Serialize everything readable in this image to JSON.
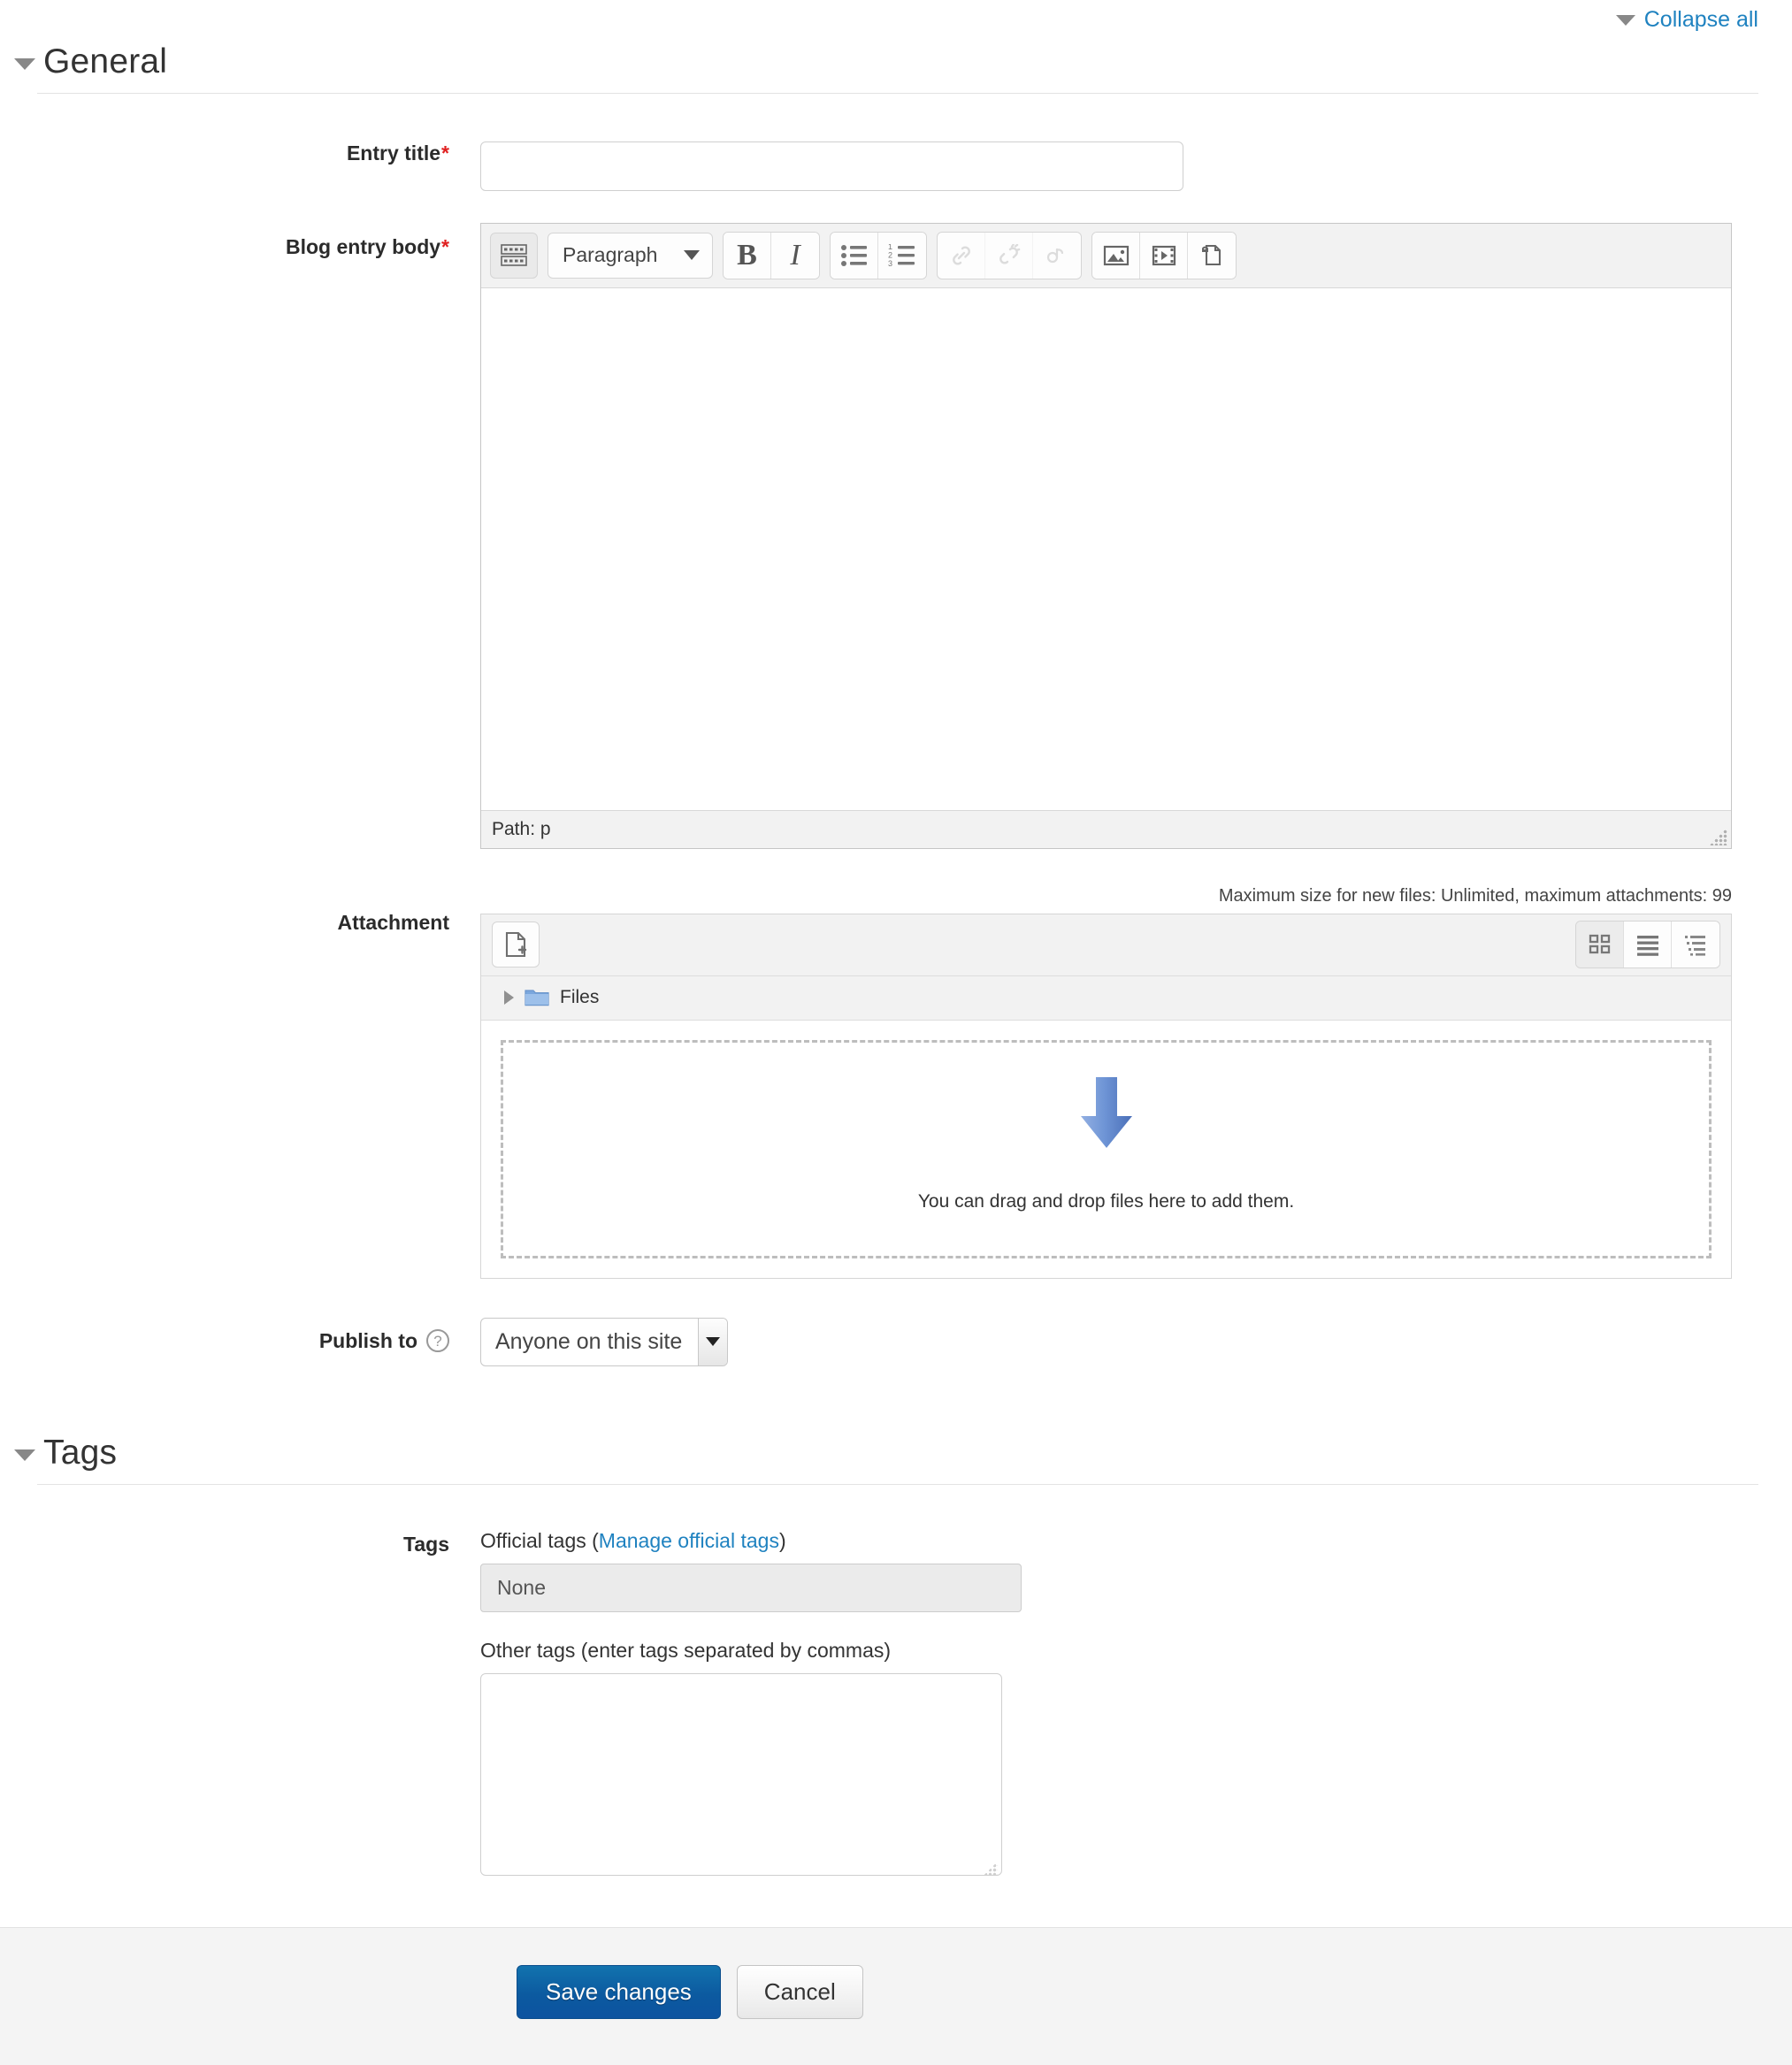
{
  "header": {
    "collapse_all": "Collapse all"
  },
  "sections": {
    "general": {
      "title": "General"
    },
    "tags": {
      "title": "Tags"
    }
  },
  "form": {
    "entry_title": {
      "label": "Entry title",
      "required_mark": "*",
      "value": "",
      "placeholder": ""
    },
    "blog_entry_body": {
      "label": "Blog entry body",
      "required_mark": "*",
      "value": "",
      "path_label": "Path: p",
      "toolbar": {
        "expand_label": "",
        "format_select": "Paragraph",
        "bold_label": "B",
        "italic_label": "I",
        "icons": [
          "expand-toolbar-icon",
          "bold-icon",
          "italic-icon",
          "bulleted-list-icon",
          "numbered-list-icon",
          "link-icon",
          "unlink-icon",
          "auto-link-icon",
          "image-icon",
          "media-icon",
          "manage-files-icon"
        ]
      }
    },
    "attachment": {
      "label": "Attachment",
      "max_size_text": "Maximum size for new files: Unlimited, maximum attachments: 99",
      "add_file_label": "",
      "breadcrumb_root": "Files",
      "dropzone_text": "You can drag and drop files here to add them.",
      "view_modes": [
        "icons-view",
        "list-view",
        "tree-view"
      ],
      "active_view": "icons-view"
    },
    "publish_to": {
      "label": "Publish to",
      "value": "Anyone on this site",
      "help": "?"
    },
    "tags": {
      "label": "Tags",
      "official_caption_prefix": "Official tags (",
      "official_caption_link": "Manage official tags",
      "official_caption_suffix": ")",
      "official_value": "None",
      "other_label": "Other tags (enter tags separated by commas)",
      "other_value": "",
      "other_placeholder": ""
    }
  },
  "footer": {
    "save_label": "Save changes",
    "cancel_label": "Cancel"
  },
  "colors": {
    "link": "#1f82c0",
    "required": "#e02020",
    "primary_button": "#0c5aa0",
    "footer_bg": "#f4f4f4",
    "arrow_blue": "#5b7fd1"
  }
}
